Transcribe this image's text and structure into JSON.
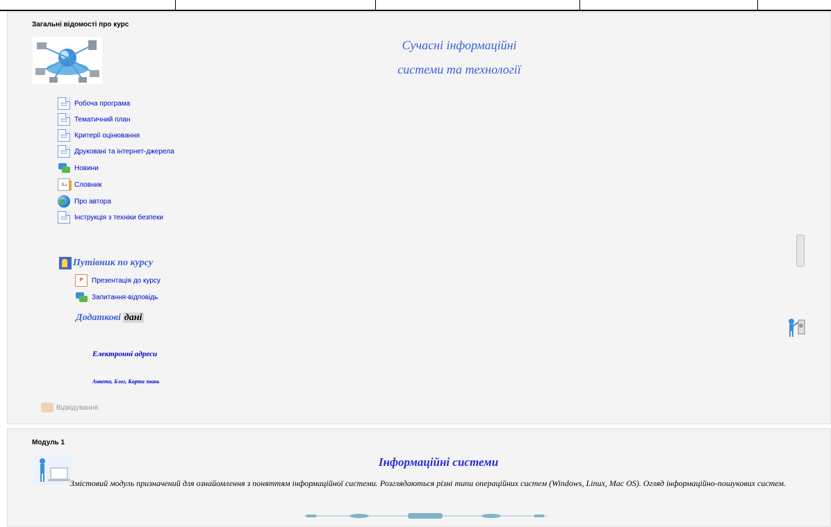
{
  "section_general": {
    "title": "Загальні відомості про курс",
    "course_title_line1": "Сучасні інформаційні",
    "course_title_line2": "системи та технології",
    "resources": [
      {
        "label": "Робоча програма",
        "icon": "page-icon"
      },
      {
        "label": "Тематичний план",
        "icon": "page-icon"
      },
      {
        "label": "Критерії оцінювання",
        "icon": "page-icon"
      },
      {
        "label": "Друковані та інтернет-джерела",
        "icon": "page-icon"
      },
      {
        "label": "Новини",
        "icon": "forum-icon"
      },
      {
        "label": "Словник",
        "icon": "glossary-icon"
      },
      {
        "label": "Про автора",
        "icon": "globe-icon"
      },
      {
        "label": "Інструкція з техніки безпеки",
        "icon": "page-icon"
      }
    ],
    "guide_title": "Путівник по курсу",
    "guide_items": [
      {
        "label": "Презентація до курсу",
        "icon": "presentation-icon"
      },
      {
        "label": "Запитання-відповідь",
        "icon": "forum-icon"
      }
    ],
    "extra_word1": "Додаткові",
    "extra_word2": "дані",
    "email_label": "Електронні адреси",
    "links_label": "Анкета, Блог, Карта знань",
    "attendance_label": "Відвідування"
  },
  "module1": {
    "title": "Модуль 1",
    "heading": "Інформаційні системи",
    "description": "Змістовий модуль призначений для ознайомлення з поняттям інформаційної системи. Розглядаються різні типи операційних систем (Windows, Linux, Mac OS). Огляд інформаційно-пошукових систем."
  },
  "colors": {
    "accent_blue": "#3a5fd9",
    "link_blue": "#0000cc",
    "section_bg": "#f4f4f4"
  }
}
